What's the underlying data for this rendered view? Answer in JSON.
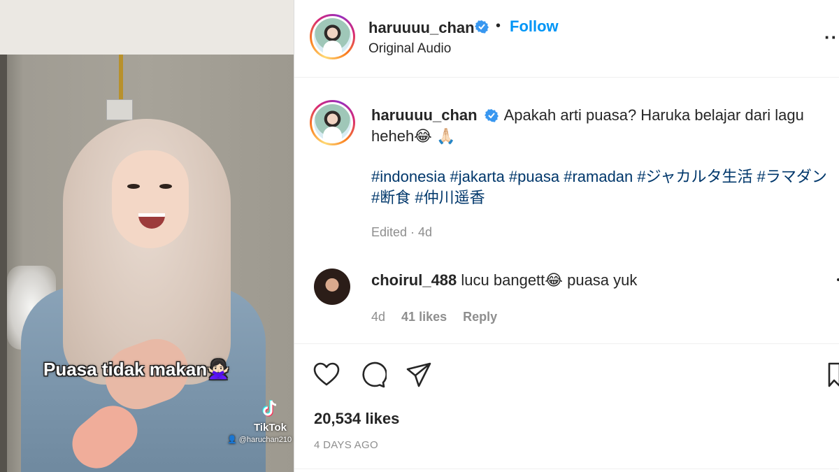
{
  "video": {
    "subtitle": "Puasa tidak makan🙅🏻‍♀️",
    "watermark_brand": "TikTok",
    "watermark_user": "👤 @haruchan210"
  },
  "post": {
    "username": "haruuuu_chan",
    "separator": "•",
    "follow_label": "Follow",
    "audio_label": "Original Audio",
    "more_label": "···",
    "caption_line1": "Apakah arti puasa? Haruka belajar dari lagu",
    "caption_line2": "heheh😂 🙏🏻",
    "hashtags_line1": "#indonesia #jakarta #puasa #ramadan #ジャカルタ生活 #ラマダン",
    "hashtags_line2": "#断食 #仲川遥香",
    "edited": "Edited · 4d"
  },
  "comment": {
    "username": "choirul_488",
    "text": "lucu bangett😂 puasa yuk",
    "age": "4d",
    "likes": "41 likes",
    "reply_label": "Reply"
  },
  "footer": {
    "likes": "20,534 likes",
    "time": "4 DAYS AGO"
  },
  "icons": [
    "verified-icon",
    "heart-icon",
    "comment-icon",
    "share-icon",
    "bookmark-icon",
    "more-icon"
  ],
  "colors": {
    "link": "#0095f6",
    "hashtag": "#00376b",
    "muted": "#8e8e8e",
    "text": "#262626",
    "verified": "#3897f0"
  }
}
